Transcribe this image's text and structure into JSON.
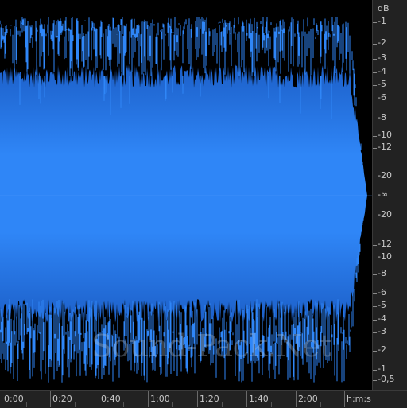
{
  "editor": {
    "waveform_color": "#2f86f7",
    "waveform_dark_color": "#1c5fc8",
    "background_color": "#000000"
  },
  "watermark": {
    "text": "Sound-Pack.Net"
  },
  "level_ruler": {
    "unit": "dB",
    "labels": [
      "-1",
      "-2",
      "-3",
      "-4",
      "-5",
      "-6",
      "-8",
      "-10",
      "-12",
      "-20",
      "-∞",
      "-20",
      "-12",
      "-10",
      "-8",
      "-6",
      "-5",
      "-4",
      "-3",
      "-2",
      "-1",
      "-0,5"
    ]
  },
  "time_ruler": {
    "labels": [
      "0:00",
      "0:20",
      "0:40",
      "1:00",
      "1:20",
      "1:40",
      "2:00"
    ],
    "unit": "h:m:s"
  }
}
